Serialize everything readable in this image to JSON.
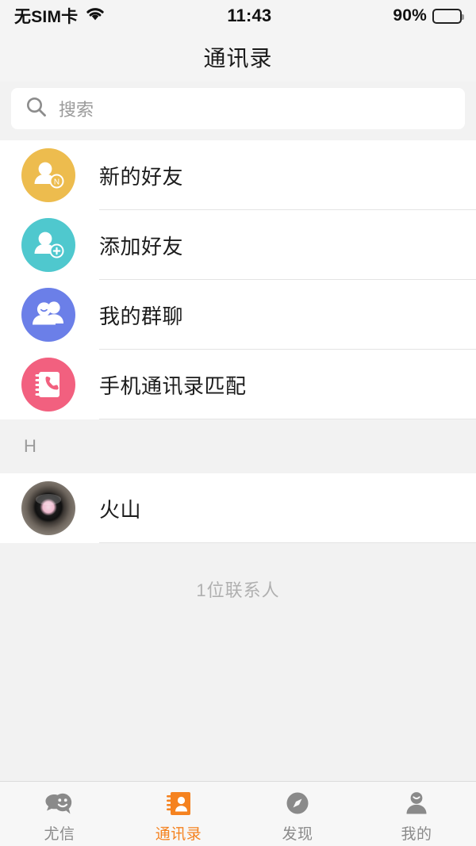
{
  "status_bar": {
    "carrier": "无SIM卡",
    "wifi_icon": "wifi-icon",
    "time": "11:43",
    "battery_percent": "90%",
    "battery_level": 90,
    "battery_icon": "battery-icon"
  },
  "nav": {
    "title": "通讯录"
  },
  "search": {
    "icon": "search-icon",
    "placeholder": "搜索",
    "value": ""
  },
  "menu": {
    "items": [
      {
        "label": "新的好友",
        "icon": "new-friend-icon",
        "color": "#EDBC4E",
        "badge": "N"
      },
      {
        "label": "添加好友",
        "icon": "add-friend-icon",
        "color": "#4FC8CE",
        "badge": "+"
      },
      {
        "label": "我的群聊",
        "icon": "group-chat-icon",
        "color": "#6B7FE8",
        "badge": ""
      },
      {
        "label": "手机通讯录匹配",
        "icon": "phonebook-match-icon",
        "color": "#F2607F",
        "badge": ""
      }
    ]
  },
  "contacts": {
    "sections": [
      {
        "index_letter": "H",
        "entries": [
          {
            "name": "火山",
            "avatar": "contact-photo-avatar"
          }
        ]
      }
    ],
    "count_label": "1位联系人"
  },
  "tabbar": {
    "active_color": "#F5821F",
    "inactive_color": "#8A8A8A",
    "tabs": [
      {
        "label": "尤信",
        "icon": "chat-bubbles-icon",
        "active": false
      },
      {
        "label": "通讯录",
        "icon": "address-book-icon",
        "active": true
      },
      {
        "label": "发现",
        "icon": "compass-icon",
        "active": false
      },
      {
        "label": "我的",
        "icon": "person-icon",
        "active": false
      }
    ]
  }
}
